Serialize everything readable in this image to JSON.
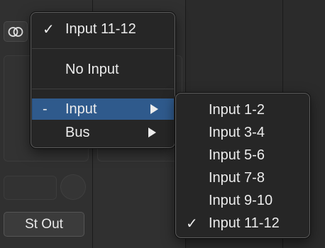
{
  "background": {
    "output_button_label": "St Out"
  },
  "input_menu": {
    "current": {
      "label": "Input 11-12",
      "checked": true
    },
    "no_input": {
      "label": "No Input"
    },
    "input": {
      "label": "Input",
      "marker": "-",
      "has_submenu": true
    },
    "bus": {
      "label": "Bus",
      "has_submenu": true
    }
  },
  "input_submenu": {
    "items": [
      {
        "label": "Input 1-2",
        "checked": false
      },
      {
        "label": "Input 3-4",
        "checked": false
      },
      {
        "label": "Input 5-6",
        "checked": false
      },
      {
        "label": "Input 7-8",
        "checked": false
      },
      {
        "label": "Input 9-10",
        "checked": false
      },
      {
        "label": "Input 11-12",
        "checked": true
      }
    ]
  },
  "colors": {
    "menu_background": "#262626",
    "highlight": "#2f5a8c",
    "text": "#ececec"
  },
  "icons": {
    "check": "checkmark-icon",
    "stereo": "stereo-rings-icon",
    "submenu": "submenu-arrow-icon"
  }
}
